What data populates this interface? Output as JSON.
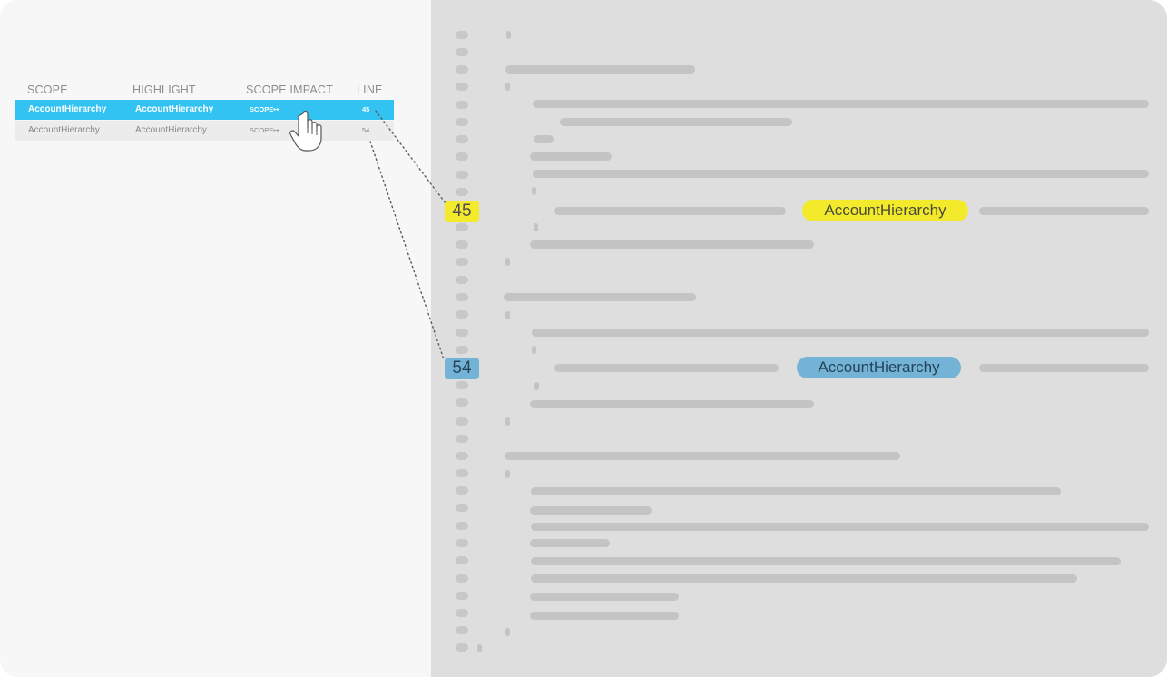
{
  "table": {
    "headers": {
      "scope": "SCOPE",
      "highlight": "HIGHLIGHT",
      "scope_impact": "SCOPE IMPACT",
      "line": "LINE"
    },
    "rows": [
      {
        "scope": "AccountHierarchy",
        "highlight": "AccountHierarchy",
        "impact": "SCOPE↦",
        "line": "45",
        "selected": true
      },
      {
        "scope": "AccountHierarchy",
        "highlight": "AccountHierarchy",
        "impact": "SCOPE↦",
        "line": "54",
        "selected": false
      }
    ]
  },
  "code_view": {
    "highlight_1": {
      "line_number": "45",
      "text": "AccountHierarchy",
      "color": "#f2ea2b"
    },
    "highlight_2": {
      "line_number": "54",
      "text": "AccountHierarchy",
      "color": "#74b3d6"
    }
  },
  "colors": {
    "selected_row": "#32c3f3",
    "code_background": "#dedede",
    "placeholder_bar": "#c4c4c4"
  },
  "cursor_icon": "hand-pointer-icon"
}
